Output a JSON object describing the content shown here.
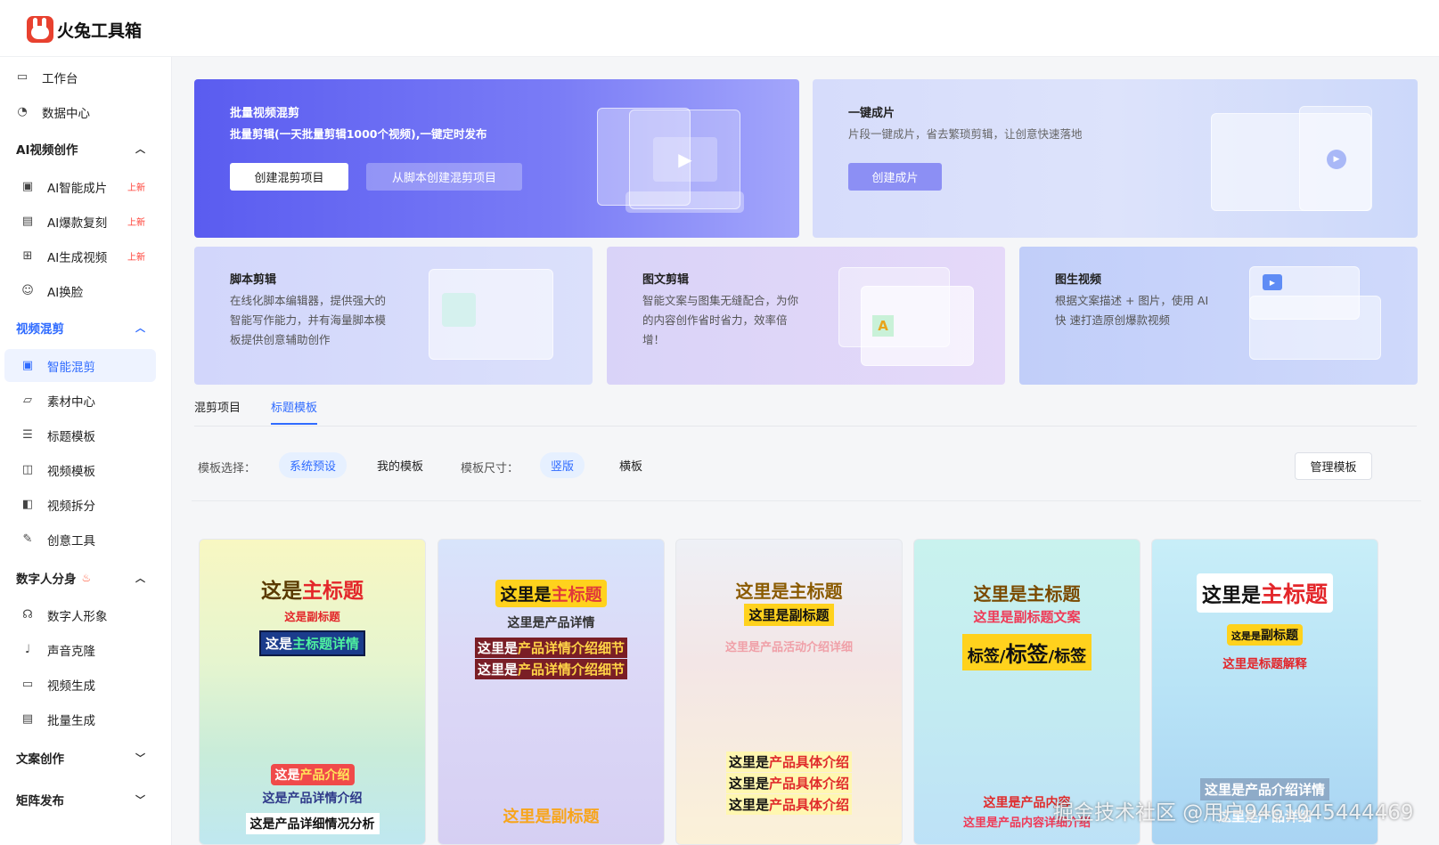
{
  "app": {
    "name": "火兔工具箱"
  },
  "sidebar": {
    "workbench": "工作台",
    "datacenter": "数据中心",
    "ai_section": "AI视频创作",
    "ai_items": [
      {
        "label": "AI智能成片",
        "badge": "上新"
      },
      {
        "label": "AI爆款复刻",
        "badge": "上新"
      },
      {
        "label": "AI生成视频",
        "badge": "上新"
      },
      {
        "label": "AI换脸"
      }
    ],
    "mix_section": "视频混剪",
    "mix_items": [
      {
        "label": "智能混剪"
      },
      {
        "label": "素材中心"
      },
      {
        "label": "标题模板"
      },
      {
        "label": "视频模板"
      },
      {
        "label": "视频拆分"
      },
      {
        "label": "创意工具"
      }
    ],
    "digital_section": "数字人分身",
    "digital_items": [
      {
        "label": "数字人形象"
      },
      {
        "label": "声音克隆"
      },
      {
        "label": "视频生成"
      },
      {
        "label": "批量生成"
      }
    ],
    "copy_section": "文案创作",
    "matrix_section": "矩阵发布"
  },
  "banners": {
    "batch": {
      "title": "批量视频混剪",
      "desc": "批量剪辑(一天批量剪辑1000个视频),一键定时发布",
      "btn1": "创建混剪项目",
      "btn2": "从脚本创建混剪项目"
    },
    "oneclick": {
      "title": "一键成片",
      "desc": "片段一键成片，省去繁琐剪辑，让创意快速落地",
      "btn": "创建成片"
    },
    "script": {
      "title": "脚本剪辑",
      "desc": "在线化脚本编辑器，提供强大的 智能写作能力，并有海量脚本模板提供创意辅助创作"
    },
    "imagetext": {
      "title": "图文剪辑",
      "desc": "智能文案与图集无缝配合，为你 的内容创作省时省力，效率倍增！"
    },
    "img2video": {
      "title": "图生视频",
      "desc": "根据文案描述 + 图片，使用 AI 快 速打造原创爆款视频"
    }
  },
  "tabs": [
    "混剪项目",
    "标题模板"
  ],
  "filters": {
    "template_label": "模板选择：",
    "template_opts": [
      "系统预设",
      "我的模板"
    ],
    "size_label": "模板尺寸：",
    "size_opts": [
      "竖版",
      "横板"
    ],
    "manage": "管理模板"
  },
  "templates": [
    {
      "l1a": "这是",
      "l1b": "主标题",
      "l2": "这是副标题",
      "l3a": "这是",
      "l3b": "主标题详情",
      "b1a": "这是",
      "b1b": "产品介绍",
      "b2": "这是产品详情介绍",
      "b3": "这是产品详细情况分析"
    },
    {
      "l1a": "这里是",
      "l1b": "主标题",
      "l2": "这里是产品详情",
      "l3a": "这里是",
      "l3b": "产品详情介绍细节",
      "l4a": "这里是",
      "l4b": "产品详情介绍细节",
      "b1": "这里是副标题"
    },
    {
      "l1": "这里是主标题",
      "l2": "这里是副标题",
      "l3": "这里是产品活动介绍详细",
      "b1a": "这里是",
      "b1b": "产品具体介绍",
      "b2a": "这里是",
      "b2b": "产品具体介绍",
      "b3a": "这里是",
      "b3b": "产品具体介绍"
    },
    {
      "l1": "这里是主标题",
      "l2": "这里是副标题文案",
      "l3a": "标签/",
      "l3b": "标签",
      "l3c": "/标签",
      "b1a": "这里是",
      "b1b": "产品内容",
      "b2": "这里是产品内容详细介绍"
    },
    {
      "l1a": "这里是",
      "l1b": "主标题",
      "l2a": "这是是",
      "l2b": "副标题",
      "l3": "这里是标题解释",
      "b1": "这里是产品介绍详情",
      "b2": "这里是产品详细"
    }
  ],
  "watermark": "掘金技术社区 @用户9461045444469"
}
